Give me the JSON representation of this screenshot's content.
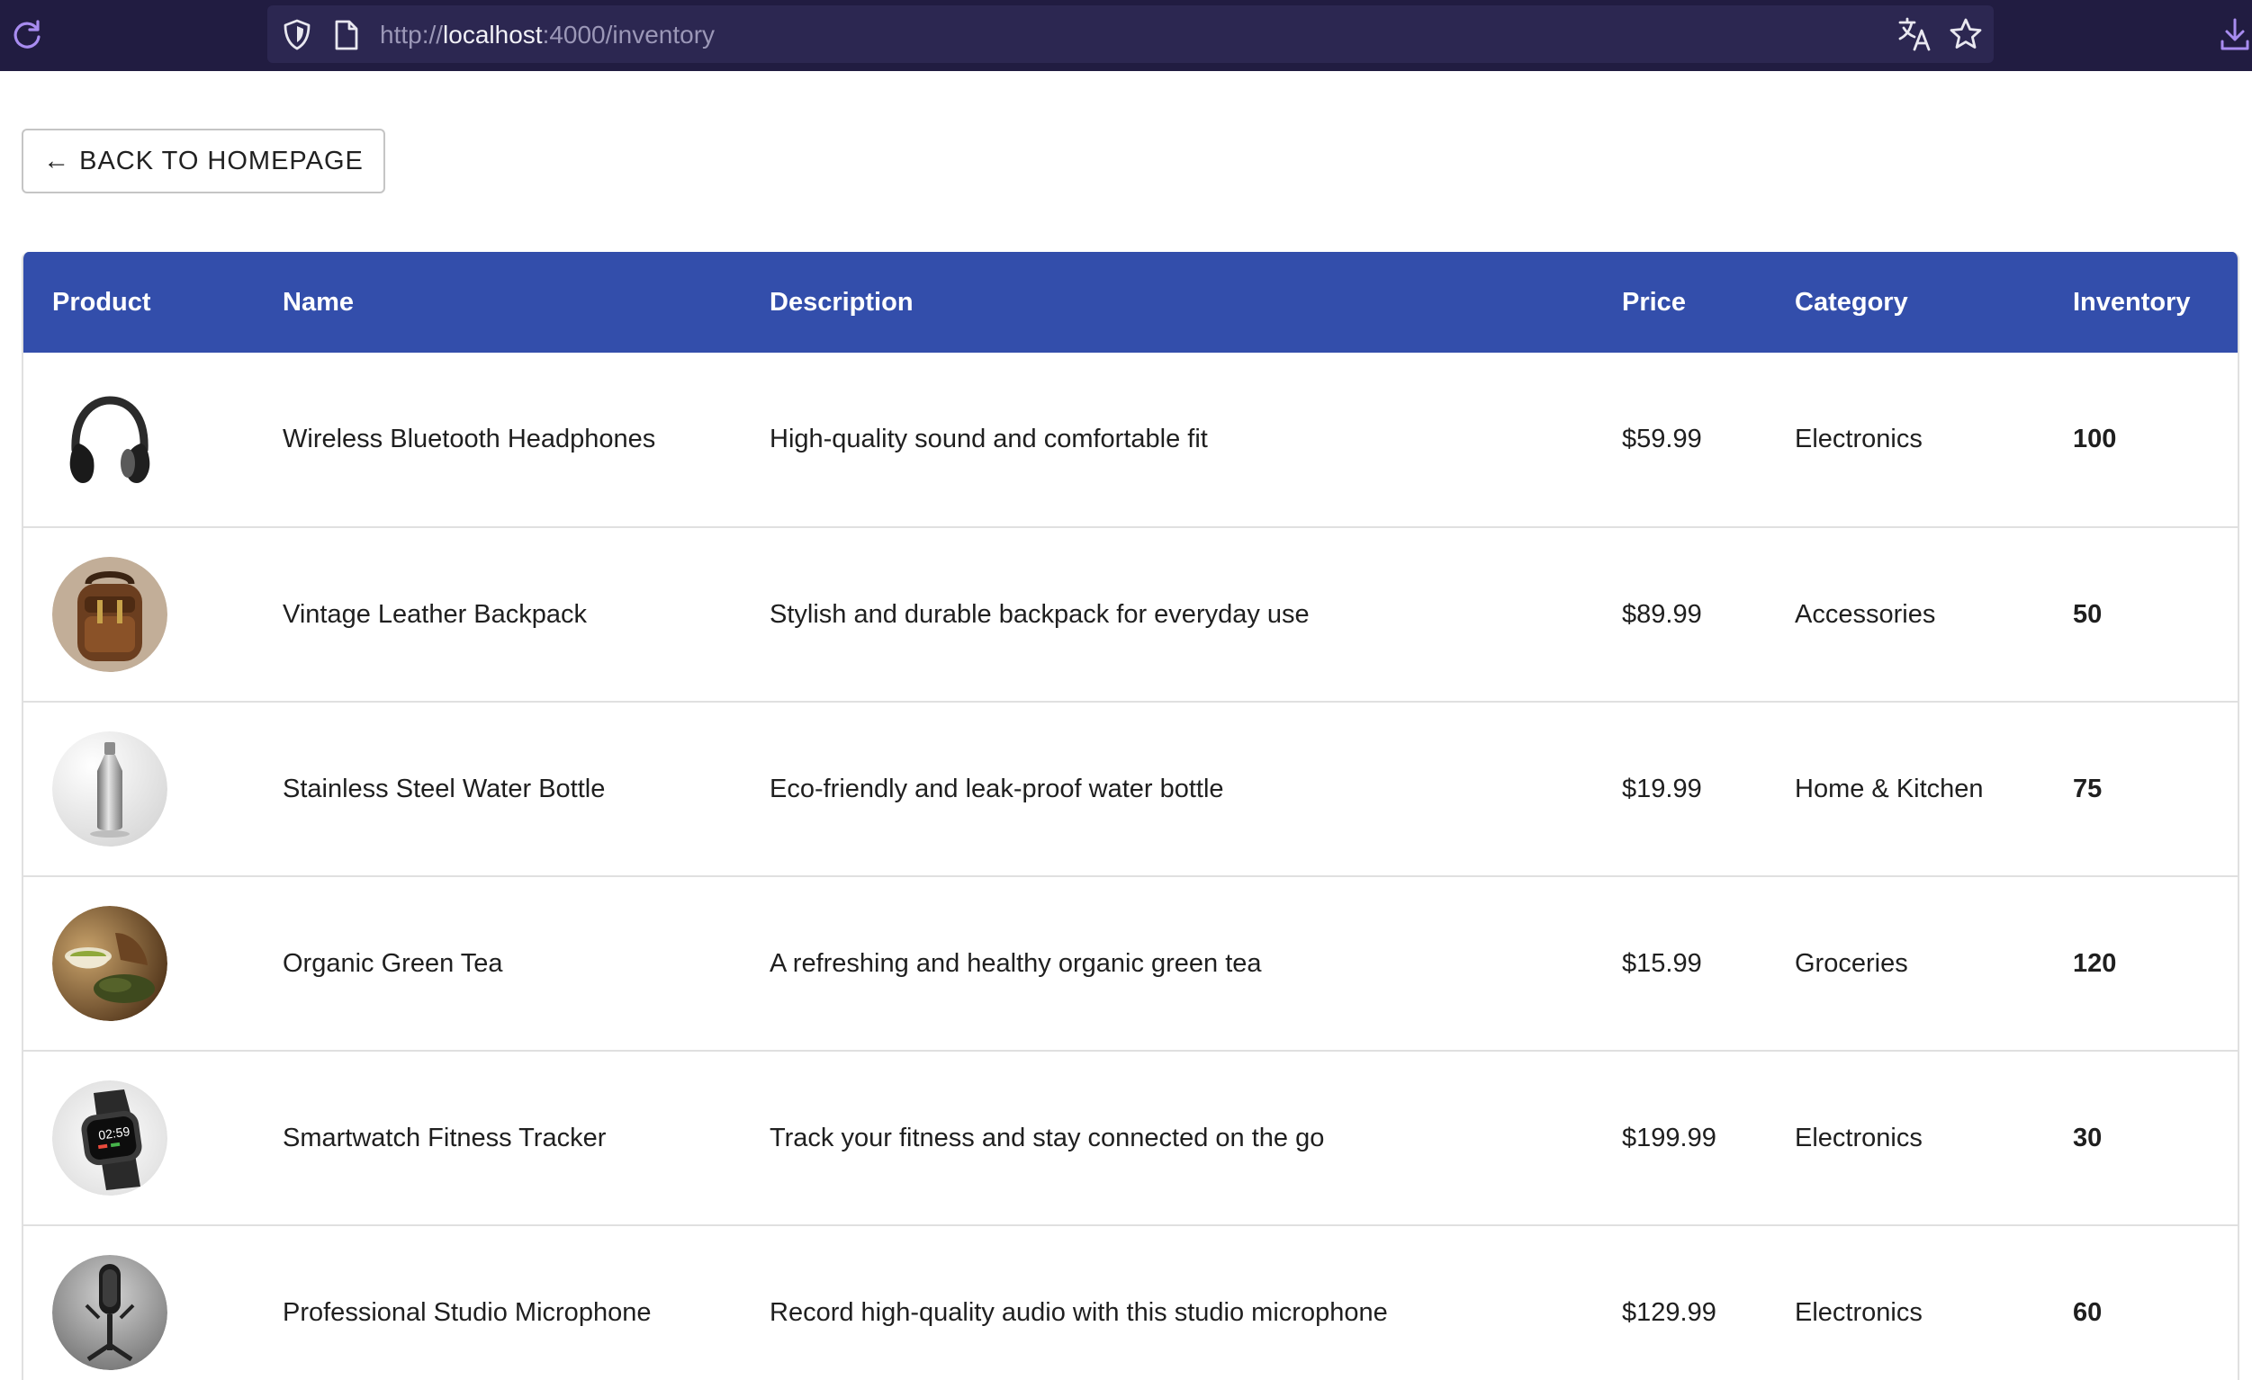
{
  "browser": {
    "url_scheme": "http://",
    "url_host": "localhost",
    "url_rest": ":4000/inventory"
  },
  "back_button": {
    "arrow": "←",
    "label": "BACK TO HOMEPAGE"
  },
  "table": {
    "headers": [
      "Product",
      "Name",
      "Description",
      "Price",
      "Category",
      "Inventory"
    ],
    "rows": [
      {
        "image": "headphones",
        "name": "Wireless Bluetooth Headphones",
        "description": "High-quality sound and comfortable fit",
        "price": "$59.99",
        "category": "Electronics",
        "inventory": "100"
      },
      {
        "image": "backpack",
        "name": "Vintage Leather Backpack",
        "description": "Stylish and durable backpack for everyday use",
        "price": "$89.99",
        "category": "Accessories",
        "inventory": "50"
      },
      {
        "image": "water-bottle",
        "name": "Stainless Steel Water Bottle",
        "description": "Eco-friendly and leak-proof water bottle",
        "price": "$19.99",
        "category": "Home & Kitchen",
        "inventory": "75"
      },
      {
        "image": "green-tea",
        "name": "Organic Green Tea",
        "description": "A refreshing and healthy organic green tea",
        "price": "$15.99",
        "category": "Groceries",
        "inventory": "120"
      },
      {
        "image": "smartwatch",
        "name": "Smartwatch Fitness Tracker",
        "description": "Track your fitness and stay connected on the go",
        "price": "$199.99",
        "category": "Electronics",
        "inventory": "30"
      },
      {
        "image": "microphone",
        "name": "Professional Studio Microphone",
        "description": "Record high-quality audio with this studio microphone",
        "price": "$129.99",
        "category": "Electronics",
        "inventory": "60"
      }
    ]
  },
  "colors": {
    "browser_bar": "#211c41",
    "url_field": "#2c2751",
    "icon_accent": "#a88cf0",
    "table_header": "#334eab"
  }
}
